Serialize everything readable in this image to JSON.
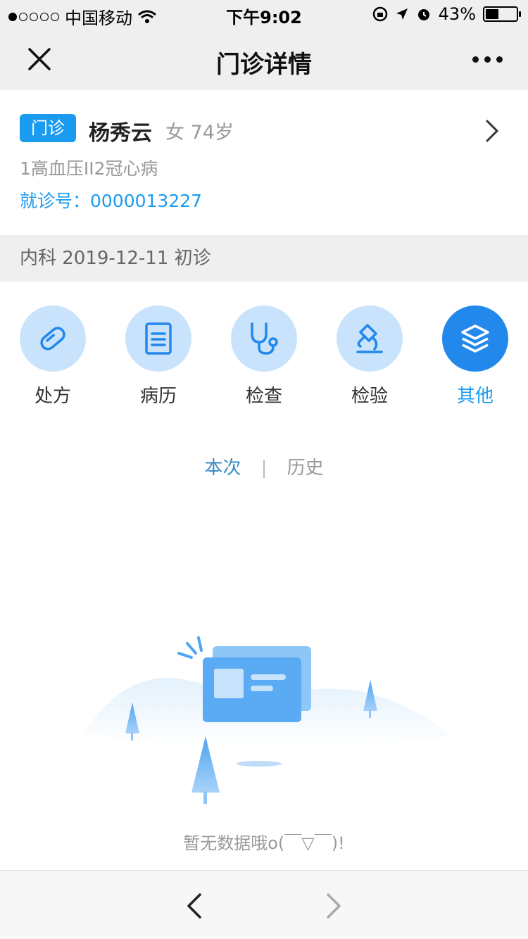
{
  "status_bar": {
    "carrier": "中国移动",
    "time": "下午9:02",
    "battery": "43%",
    "battery_level": 0.43,
    "signal_bars_filled": 1,
    "signal_bars_total": 5
  },
  "nav": {
    "title": "门诊详情"
  },
  "patient": {
    "badge": "门诊",
    "name": "杨秀云",
    "meta": "女 74岁",
    "diagnosis": "1高血压II2冠心病",
    "visit_no": "就诊号：0000013227"
  },
  "section": {
    "header": "内科 2019-12-11 初诊"
  },
  "categories": [
    {
      "label": "处方",
      "icon": "pill-icon",
      "active": false
    },
    {
      "label": "病历",
      "icon": "document-icon",
      "active": false
    },
    {
      "label": "检查",
      "icon": "stethoscope-icon",
      "active": false
    },
    {
      "label": "检验",
      "icon": "microscope-icon",
      "active": false
    },
    {
      "label": "其他",
      "icon": "layers-icon",
      "active": true
    }
  ],
  "tabs": {
    "current": "本次",
    "separator": "|",
    "history": "历史"
  },
  "empty": {
    "text": "暂无数据哦o(￣▽￣)!"
  },
  "colors": {
    "accent": "#1a9bf0",
    "icon_bg": "#c8e3fb",
    "icon_active_bg": "#2288ec"
  }
}
